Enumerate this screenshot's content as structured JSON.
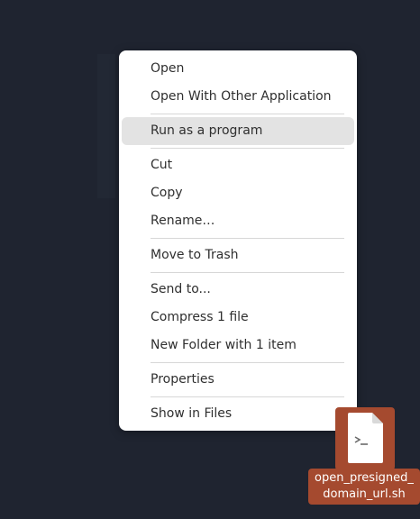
{
  "context_menu": {
    "open": "Open",
    "open_with": "Open With Other Application",
    "run_as_program": "Run as a program",
    "cut": "Cut",
    "copy": "Copy",
    "rename": "Rename…",
    "move_to_trash": "Move to Trash",
    "send_to": "Send to...",
    "compress": "Compress 1 file",
    "new_folder_with_item": "New Folder with 1 item",
    "properties": "Properties",
    "show_in_files": "Show in Files"
  },
  "desktop_file": {
    "name_line1": "open_presigned_",
    "name_line2": "domain_url.sh",
    "icon": "script-file-icon",
    "selection_color": "#a54a2f"
  },
  "colors": {
    "desktop_background": "#1f2430",
    "menu_background": "#ffffff",
    "hover_background": "#e3e3e3"
  }
}
